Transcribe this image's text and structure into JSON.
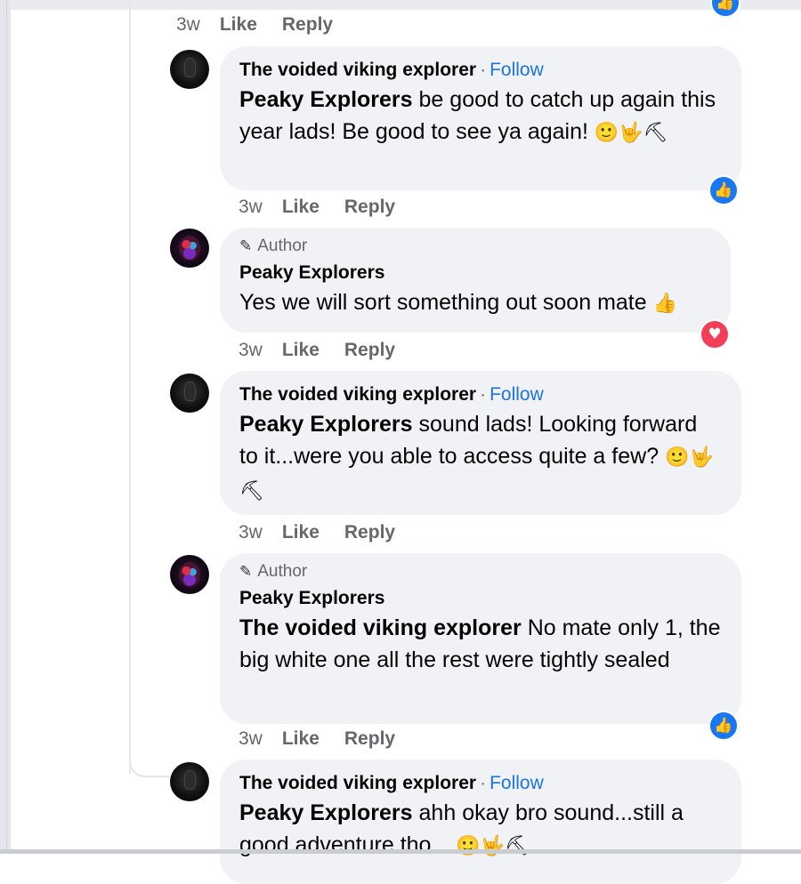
{
  "actions": {
    "time": "3w",
    "like_label": "Like",
    "reply_label": "Reply"
  },
  "colors": {
    "link_blue": "#1b74e4",
    "bubble_bg": "#f0f2f5",
    "like_reaction": "#1877f2",
    "love_reaction": "#f33e58"
  },
  "comments": [
    {
      "name": "The voided viking explorer",
      "follow": "Follow",
      "mention": "Peaky Explorers",
      "text": "be good to catch up again this year lads! Be good to see ya again!",
      "emojis": "🙂🤟⛏",
      "reaction": "like-icon",
      "time": "3w"
    },
    {
      "badge": "Author",
      "badge_icon": "pencil-icon",
      "name": "Peaky Explorers",
      "text": "Yes we will sort something out soon mate",
      "emojis": "👍",
      "reaction": "love-icon",
      "time": "3w"
    },
    {
      "name": "The voided viking explorer",
      "follow": "Follow",
      "mention": "Peaky Explorers",
      "text": "sound lads! Looking forward to it...were you able to access quite a few?",
      "emojis": "🙂🤟⛏",
      "time": "3w"
    },
    {
      "badge": "Author",
      "badge_icon": "pencil-icon",
      "name": "Peaky Explorers",
      "mention": "The voided viking explorer",
      "text": "No mate only 1, the big white one all the rest were tightly sealed",
      "reaction": "like-icon",
      "time": "3w"
    },
    {
      "name": "The voided viking explorer",
      "follow": "Follow",
      "mention": "Peaky Explorers",
      "text": "ahh okay bro sound...still a good adventure tho...",
      "emojis": "🙂🤟⛏"
    }
  ]
}
